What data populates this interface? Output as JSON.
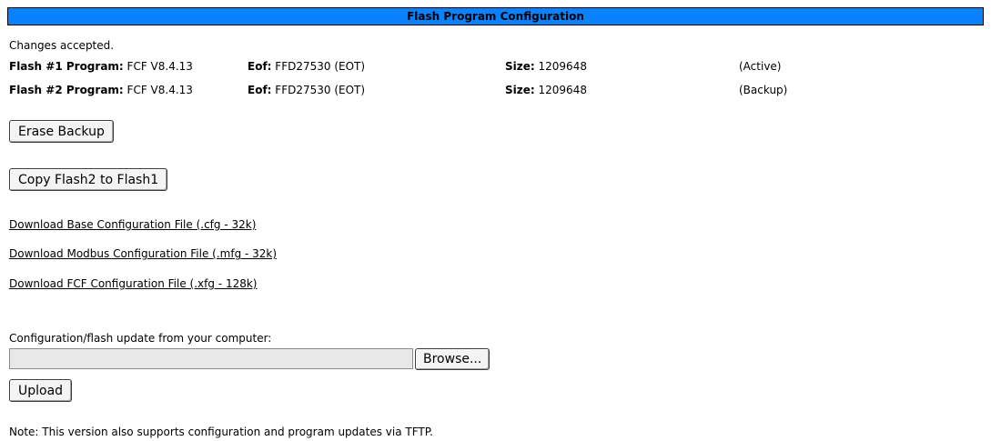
{
  "header": {
    "title": "Flash Program Configuration"
  },
  "status_message": "Changes accepted.",
  "flash_rows": [
    {
      "program_label": "Flash #1 Program:",
      "program_value": "FCF V8.4.13",
      "eof_label": "Eof:",
      "eof_value": "FFD27530 (EOT)",
      "size_label": "Size:",
      "size_value": "1209648",
      "state": "(Active)"
    },
    {
      "program_label": "Flash #2 Program:",
      "program_value": "FCF V8.4.13",
      "eof_label": "Eof:",
      "eof_value": "FFD27530 (EOT)",
      "size_label": "Size:",
      "size_value": "1209648",
      "state": "(Backup)"
    }
  ],
  "buttons": {
    "erase_backup": "Erase Backup",
    "copy_flash": "Copy Flash2 to Flash1",
    "browse": "Browse...",
    "upload": "Upload"
  },
  "download_links": [
    "Download Base Configuration File (.cfg - 32k)",
    "Download Modbus Configuration File (.mfg - 32k)",
    "Download FCF Configuration File (.xfg - 128k)"
  ],
  "upload": {
    "label": "Configuration/flash update from your computer:",
    "file_value": ""
  },
  "note": "Note: This version also supports configuration and program updates via TFTP.",
  "colors": {
    "header_bg": "#0a82ff",
    "text": "#000000"
  }
}
